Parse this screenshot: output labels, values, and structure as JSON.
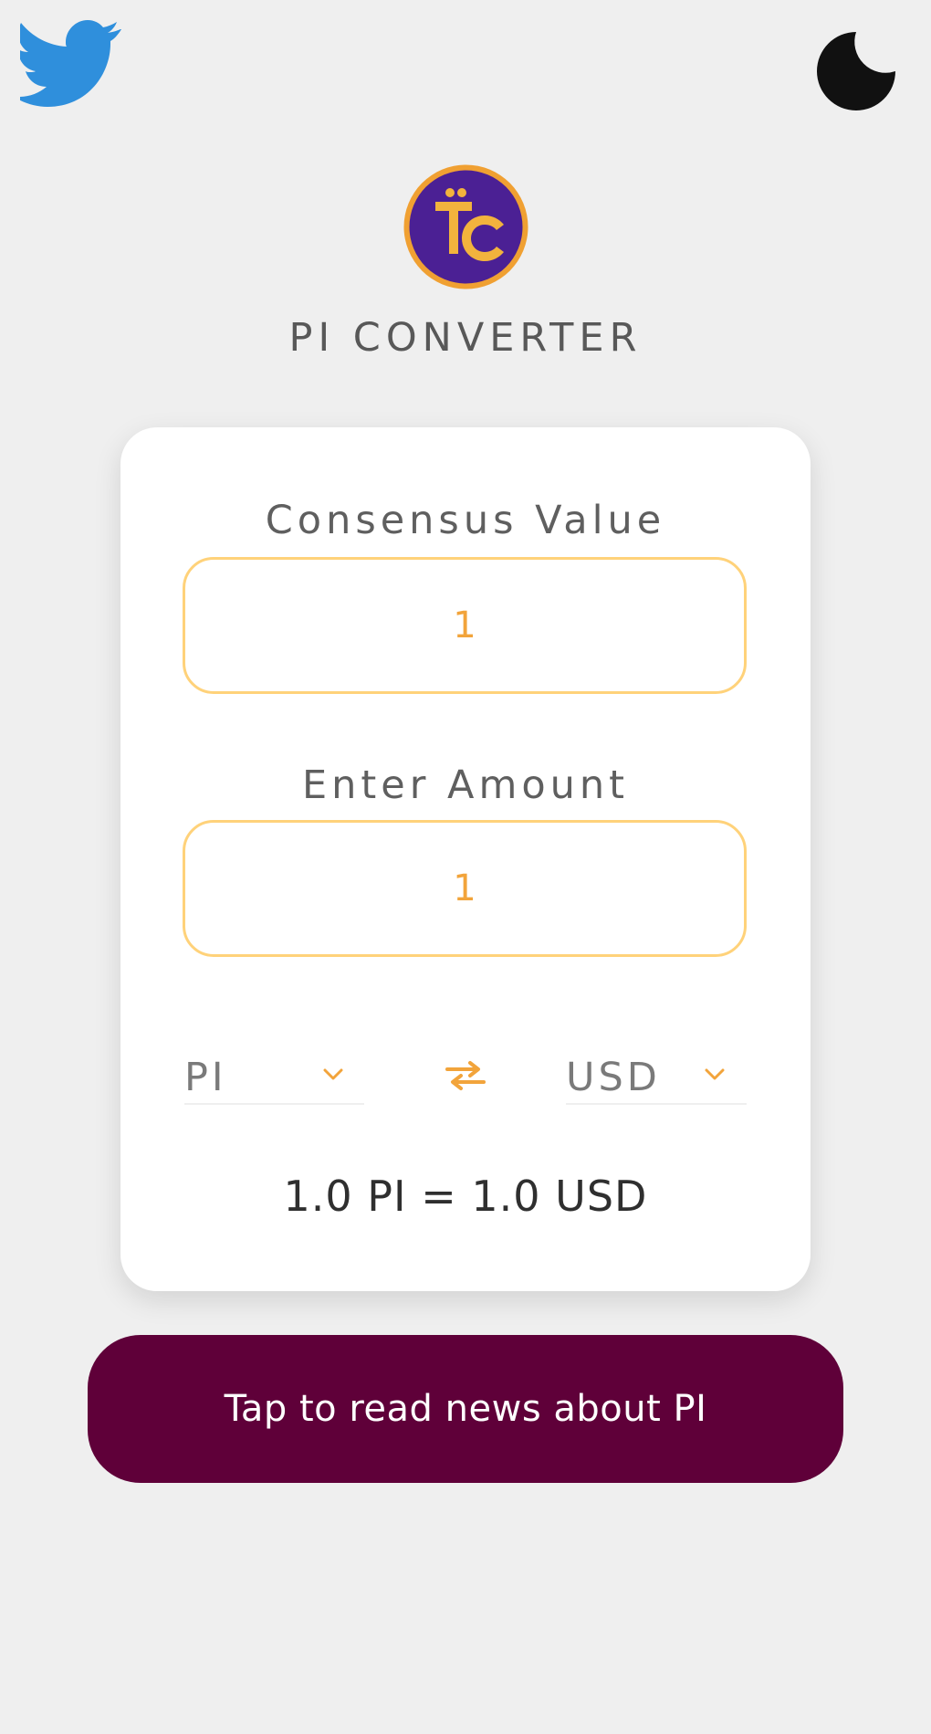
{
  "header": {
    "left_icon": "twitter-icon",
    "right_icon": "moon-icon"
  },
  "app": {
    "logo_icon": "pi-logo",
    "title": "PI CONVERTER"
  },
  "converter": {
    "consensus_label": "Consensus Value",
    "consensus_value": "1",
    "amount_label": "Enter Amount",
    "amount_value": "1",
    "from_currency": "PI",
    "to_currency": "USD",
    "swap_icon": "swap-icon",
    "chevron_icon": "chevron-down-icon",
    "result": "1.0 PI = 1.0 USD"
  },
  "news": {
    "button_label": "Tap to read news about PI"
  },
  "colors": {
    "background": "#efefef",
    "card": "#ffffff",
    "accent": "#f2a43b",
    "input_border": "#ffd27a",
    "button": "#5f0039",
    "logo_ring": "#f0a032",
    "logo_fill": "#4b2094"
  }
}
